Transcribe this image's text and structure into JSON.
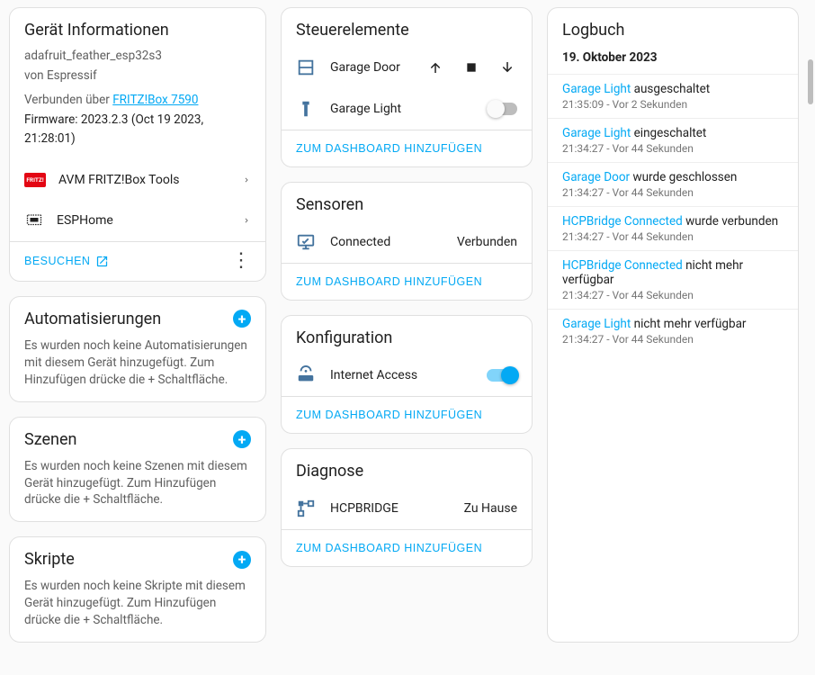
{
  "devinfo": {
    "title": "Gerät Informationen",
    "model": "adafruit_feather_esp32s3",
    "manufacturer_line": "von Espressif",
    "connected_prefix": "Verbunden über ",
    "connected_link": "FRITZ!Box 7590",
    "firmware": "Firmware: 2023.2.3 (Oct 19 2023, 21:28:01)",
    "integrations": [
      {
        "icon": "fritz",
        "label": "AVM FRITZ!Box Tools"
      },
      {
        "icon": "esphome",
        "label": "ESPHome"
      }
    ],
    "visit": "BESUCHEN"
  },
  "automations": {
    "title": "Automatisierungen",
    "text": "Es wurden noch keine Automatisierungen mit diesem Gerät hinzugefügt. Zum Hinzufügen drücke die + Schaltfläche."
  },
  "scenes": {
    "title": "Szenen",
    "text": "Es wurden noch keine Szenen mit diesem Gerät hinzugefügt. Zum Hinzufügen drücke die + Schaltfläche."
  },
  "scripts": {
    "title": "Skripte",
    "text": "Es wurden noch keine Skripte mit diesem Gerät hinzugefügt. Zum Hinzufügen drücke die + Schaltfläche."
  },
  "controls": {
    "title": "Steuerelemente",
    "entities": [
      {
        "id": "garage-door",
        "type": "cover",
        "label": "Garage Door"
      },
      {
        "id": "garage-light",
        "type": "light",
        "label": "Garage Light",
        "on": false
      }
    ],
    "dash": "ZUM DASHBOARD HINZUFÜGEN"
  },
  "sensors": {
    "title": "Sensoren",
    "entities": [
      {
        "id": "connected",
        "label": "Connected",
        "state": "Verbunden"
      }
    ],
    "dash": "ZUM DASHBOARD HINZUFÜGEN"
  },
  "config": {
    "title": "Konfiguration",
    "entities": [
      {
        "id": "internet-access",
        "label": "Internet Access",
        "on": true
      }
    ],
    "dash": "ZUM DASHBOARD HINZUFÜGEN"
  },
  "diag": {
    "title": "Diagnose",
    "entities": [
      {
        "id": "hcpbridge",
        "label": "HCPBRIDGE",
        "state": "Zu Hause"
      }
    ],
    "dash": "ZUM DASHBOARD HINZUFÜGEN"
  },
  "logbook": {
    "title": "Logbuch",
    "date": "19. Oktober 2023",
    "entries": [
      {
        "entity": "Garage Light",
        "rest": " ausgeschaltet",
        "time": "21:35:09",
        "rel": "Vor 2 Sekunden"
      },
      {
        "entity": "Garage Light",
        "rest": " eingeschaltet",
        "time": "21:34:27",
        "rel": "Vor 44 Sekunden"
      },
      {
        "entity": "Garage Door",
        "rest": " wurde geschlossen",
        "time": "21:34:27",
        "rel": "Vor 44 Sekunden"
      },
      {
        "entity": "HCPBridge Connected",
        "rest": " wurde verbunden",
        "time": "21:34:27",
        "rel": "Vor 44 Sekunden"
      },
      {
        "entity": "HCPBridge Connected",
        "rest": " nicht mehr verfügbar",
        "time": "21:34:27",
        "rel": "Vor 44 Sekunden"
      },
      {
        "entity": "Garage Light",
        "rest": " nicht mehr verfügbar",
        "time": "21:34:27",
        "rel": "Vor 44 Sekunden"
      }
    ]
  }
}
